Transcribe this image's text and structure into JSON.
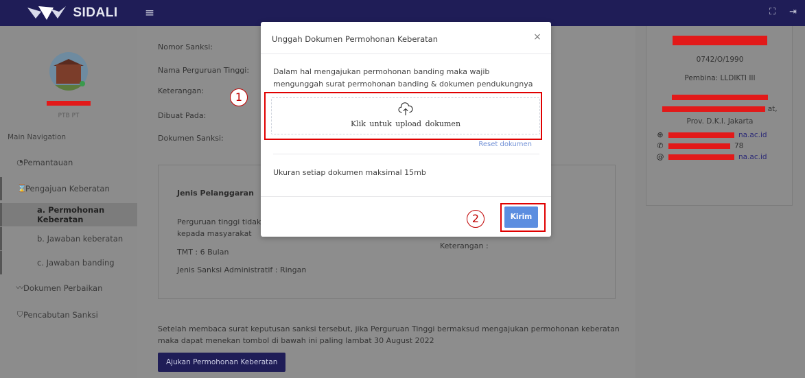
{
  "app": {
    "name": "SIDALI",
    "colors": {
      "topbar": "#1f1d57",
      "accent": "#5b8ee0",
      "annotation": "#e00000",
      "link": "#6f8fd6"
    }
  },
  "user": {
    "role": "PTB PT"
  },
  "sidebar": {
    "heading": "Main Navigation",
    "items": [
      {
        "label": "Pemantauan",
        "icon": "gauge-icon"
      },
      {
        "label": "Pengajuan Keberatan",
        "icon": "hourglass-icon"
      },
      {
        "label": "a. Permohonan Keberatan",
        "active": true
      },
      {
        "label": "b. Jawaban keberatan"
      },
      {
        "label": "c. Jawaban banding"
      },
      {
        "label": "Dokumen Perbaikan",
        "icon": "trend-icon"
      },
      {
        "label": "Pencabutan Sanksi",
        "icon": "shield-icon"
      }
    ]
  },
  "detail": {
    "labels": {
      "nomor": "Nomor Sanksi:",
      "nama": "Nama Perguruan Tinggi:",
      "keterangan": "Keterangan:",
      "dibuat": "Dibuat Pada:",
      "dokumen": "Dokumen Sanksi:"
    },
    "violation": {
      "heading": "Jenis Pelanggaran",
      "line1": "Perguruan tinggi tidak m",
      "line2": "kepada masyarakat",
      "tmt": "TMT : 6 Bulan",
      "jenis": "Jenis Sanksi Administratif : Ringan",
      "keterangan": "Keterangan :"
    },
    "notice": "Setelah membaca surat keputusan sanksi tersebut, jika Perguruan Tinggi bermaksud mengajukan permohonan keberatan maka dapat menekan tombol di bawah ini paling lambat 30 August 2022",
    "submit_label": "Ajukan Permohonan Keberatan"
  },
  "institution": {
    "code": "0742/O/1990",
    "pembina": "Pembina: LLDIKTI III",
    "address_tail": "at,",
    "province": "Prov. D.K.I. Jakarta",
    "website_tail": "na.ac.id",
    "phone_tail": "78",
    "email_tail": "na.ac.id"
  },
  "modal": {
    "title": "Unggah Dokumen Permohonan Keberatan",
    "description": "Dalam hal mengajukan permohonan banding maka wajib mengunggah surat permohonan banding & dokumen pendukungnya",
    "upload_label": "Klik untuk upload dokumen",
    "reset_label": "Reset dokumen",
    "size_note": "Ukuran setiap dokumen maksimal 15mb",
    "submit_label": "Kirim"
  },
  "annotations": {
    "step1": "1",
    "step2": "2"
  }
}
